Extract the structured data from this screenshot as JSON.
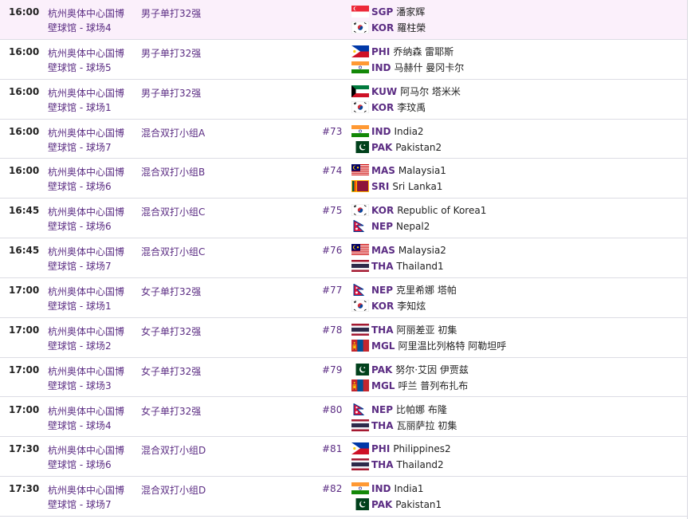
{
  "rows": [
    {
      "time": "16:00",
      "venue1": "杭州奥体中心国博",
      "venue2": "壁球馆 - 球场4",
      "event": "男子单打32强",
      "num": "",
      "highlight": true,
      "team1": {
        "code": "SGP",
        "name": "潘家辉",
        "flag": "SGP"
      },
      "team2": {
        "code": "KOR",
        "name": "羅柱榮",
        "flag": "KOR"
      }
    },
    {
      "time": "16:00",
      "venue1": "杭州奥体中心国博",
      "venue2": "壁球馆 - 球场5",
      "event": "男子单打32强",
      "num": "",
      "team1": {
        "code": "PHI",
        "name": "乔纳森 雷耶斯",
        "flag": "PHI"
      },
      "team2": {
        "code": "IND",
        "name": "马赫什 曼冈卡尔",
        "flag": "IND"
      }
    },
    {
      "time": "16:00",
      "venue1": "杭州奥体中心国博",
      "venue2": "壁球馆 - 球场1",
      "event": "男子单打32强",
      "num": "",
      "team1": {
        "code": "KUW",
        "name": "阿马尔 塔米米",
        "flag": "KUW"
      },
      "team2": {
        "code": "KOR",
        "name": "李玟禹",
        "flag": "KOR"
      }
    },
    {
      "time": "16:00",
      "venue1": "杭州奥体中心国博",
      "venue2": "壁球馆 - 球场7",
      "event": "混合双打小组A",
      "num": "#73",
      "team1": {
        "code": "IND",
        "name": "India2",
        "flag": "IND"
      },
      "team2": {
        "code": "PAK",
        "name": "Pakistan2",
        "flag": "PAK"
      }
    },
    {
      "time": "16:00",
      "venue1": "杭州奥体中心国博",
      "venue2": "壁球馆 - 球场6",
      "event": "混合双打小组B",
      "num": "#74",
      "team1": {
        "code": "MAS",
        "name": "Malaysia1",
        "flag": "MAS"
      },
      "team2": {
        "code": "SRI",
        "name": "Sri Lanka1",
        "flag": "SRI"
      }
    },
    {
      "time": "16:45",
      "venue1": "杭州奥体中心国博",
      "venue2": "壁球馆 - 球场6",
      "event": "混合双打小组C",
      "num": "#75",
      "team1": {
        "code": "KOR",
        "name": "Republic of Korea1",
        "flag": "KOR"
      },
      "team2": {
        "code": "NEP",
        "name": "Nepal2",
        "flag": "NEP"
      }
    },
    {
      "time": "16:45",
      "venue1": "杭州奥体中心国博",
      "venue2": "壁球馆 - 球场7",
      "event": "混合双打小组C",
      "num": "#76",
      "team1": {
        "code": "MAS",
        "name": "Malaysia2",
        "flag": "MAS"
      },
      "team2": {
        "code": "THA",
        "name": "Thailand1",
        "flag": "THA"
      }
    },
    {
      "time": "17:00",
      "venue1": "杭州奥体中心国博",
      "venue2": "壁球馆 - 球场1",
      "event": "女子单打32强",
      "num": "#77",
      "team1": {
        "code": "NEP",
        "name": "克里希娜 塔帕",
        "flag": "NEP"
      },
      "team2": {
        "code": "KOR",
        "name": "李知炫",
        "flag": "KOR"
      }
    },
    {
      "time": "17:00",
      "venue1": "杭州奥体中心国博",
      "venue2": "壁球馆 - 球场2",
      "event": "女子单打32强",
      "num": "#78",
      "team1": {
        "code": "THA",
        "name": "阿丽差亚 初集",
        "flag": "THA"
      },
      "team2": {
        "code": "MGL",
        "name": "阿里温比列格特 阿勒坦呼",
        "flag": "MGL"
      }
    },
    {
      "time": "17:00",
      "venue1": "杭州奥体中心国博",
      "venue2": "壁球馆 - 球场3",
      "event": "女子单打32强",
      "num": "#79",
      "team1": {
        "code": "PAK",
        "name": "努尔·艾因 伊贾兹",
        "flag": "PAK"
      },
      "team2": {
        "code": "MGL",
        "name": "呼兰 普列布扎布",
        "flag": "MGL"
      }
    },
    {
      "time": "17:00",
      "venue1": "杭州奥体中心国博",
      "venue2": "壁球馆 - 球场4",
      "event": "女子单打32强",
      "num": "#80",
      "team1": {
        "code": "NEP",
        "name": "比帕娜 布隆",
        "flag": "NEP"
      },
      "team2": {
        "code": "THA",
        "name": "瓦丽萨拉 初集",
        "flag": "THA"
      }
    },
    {
      "time": "17:30",
      "venue1": "杭州奥体中心国博",
      "venue2": "壁球馆 - 球场6",
      "event": "混合双打小组D",
      "num": "#81",
      "team1": {
        "code": "PHI",
        "name": "Philippines2",
        "flag": "PHI"
      },
      "team2": {
        "code": "THA",
        "name": "Thailand2",
        "flag": "THA"
      }
    },
    {
      "time": "17:30",
      "venue1": "杭州奥体中心国博",
      "venue2": "壁球馆 - 球场7",
      "event": "混合双打小组D",
      "num": "#82",
      "team1": {
        "code": "IND",
        "name": "India1",
        "flag": "IND"
      },
      "team2": {
        "code": "PAK",
        "name": "Pakistan1",
        "flag": "PAK"
      }
    }
  ]
}
